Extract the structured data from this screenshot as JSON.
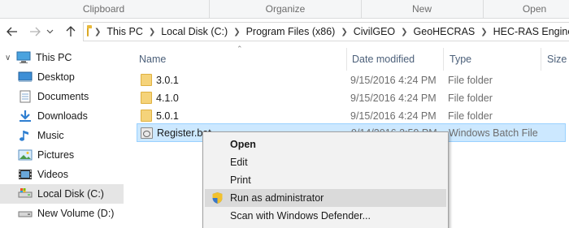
{
  "ribbon": {
    "groups": [
      "Clipboard",
      "Organize",
      "New",
      "Open"
    ]
  },
  "address": {
    "back_icon": "back-arrow-icon",
    "forward_icon": "forward-arrow-icon",
    "up_icon": "up-arrow-icon",
    "breadcrumbs": [
      "This PC",
      "Local Disk (C:)",
      "Program Files (x86)",
      "CivilGEO",
      "GeoHECRAS",
      "HEC-RAS Engines"
    ]
  },
  "sidebar": {
    "items": [
      {
        "label": "This PC",
        "icon": "computer-icon"
      },
      {
        "label": "Desktop",
        "icon": "desktop-icon"
      },
      {
        "label": "Documents",
        "icon": "documents-icon"
      },
      {
        "label": "Downloads",
        "icon": "downloads-icon"
      },
      {
        "label": "Music",
        "icon": "music-icon"
      },
      {
        "label": "Pictures",
        "icon": "pictures-icon"
      },
      {
        "label": "Videos",
        "icon": "videos-icon"
      },
      {
        "label": "Local Disk (C:)",
        "icon": "drive-icon",
        "selected": true
      },
      {
        "label": "New Volume (D:)",
        "icon": "drive-icon"
      }
    ]
  },
  "columns": {
    "name": "Name",
    "date": "Date modified",
    "type": "Type",
    "size": "Size"
  },
  "files": [
    {
      "name": "3.0.1",
      "date": "9/15/2016 4:24 PM",
      "type": "File folder",
      "icon": "folder-icon"
    },
    {
      "name": "4.1.0",
      "date": "9/15/2016 4:24 PM",
      "type": "File folder",
      "icon": "folder-icon"
    },
    {
      "name": "5.0.1",
      "date": "9/15/2016 4:24 PM",
      "type": "File folder",
      "icon": "folder-icon"
    },
    {
      "name": "Register.bat",
      "date": "9/14/2016 2:59 PM",
      "type": "Windows Batch File",
      "icon": "batch-file-icon",
      "selected": true
    }
  ],
  "context_menu": {
    "items": [
      {
        "label": "Open",
        "bold": true
      },
      {
        "label": "Edit"
      },
      {
        "label": "Print"
      },
      {
        "label": "Run as administrator",
        "icon": "uac-shield-icon",
        "hover": true
      },
      {
        "label": "Scan with Windows Defender..."
      }
    ]
  },
  "colors": {
    "selection": "#cce8ff",
    "selection_border": "#99d1ff",
    "folder": "#f5d37a",
    "header_text": "#4c607a"
  }
}
